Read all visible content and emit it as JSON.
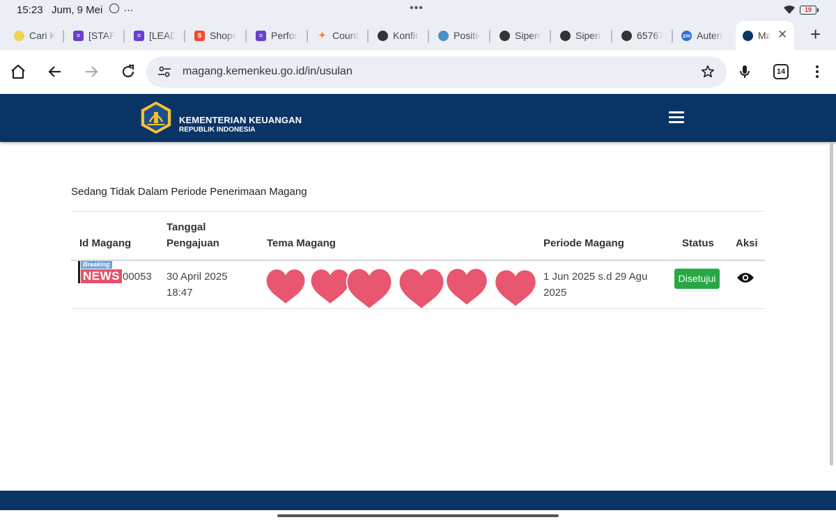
{
  "status_bar": {
    "time": "15:23",
    "date": "Jum, 9 Mei",
    "more": "…",
    "center_dots": "•••",
    "battery": "19"
  },
  "tabs": [
    {
      "title": "Cari K",
      "icon": "kakao-icon",
      "color": "#f3d24c"
    },
    {
      "title": "[STAF",
      "icon": "form-icon",
      "color": "#6a3fd1"
    },
    {
      "title": "[LEAD",
      "icon": "form-icon",
      "color": "#6a3fd1"
    },
    {
      "title": "Shope",
      "icon": "shopee-icon",
      "color": "#ee4d2d"
    },
    {
      "title": "Perfor",
      "icon": "form-icon",
      "color": "#6a3fd1"
    },
    {
      "title": "Count",
      "icon": "count-icon",
      "color": "#f08a24"
    },
    {
      "title": "Konfir",
      "icon": "globe-icon",
      "color": "#333333"
    },
    {
      "title": "Positic",
      "icon": "position-icon",
      "color": "#4a90c8"
    },
    {
      "title": "Siperr",
      "icon": "globe-icon",
      "color": "#333333"
    },
    {
      "title": "Siperr",
      "icon": "globe-icon",
      "color": "#333333"
    },
    {
      "title": "65767",
      "icon": "globe-icon",
      "color": "#333333"
    },
    {
      "title": "Auten",
      "icon": "zm-icon",
      "color": "#2a6bd8"
    },
    {
      "title": "Ma",
      "icon": "kemenkeu-icon",
      "color": "#0a3466",
      "active": true
    }
  ],
  "toolbar": {
    "url": "magang.kemenkeu.go.id/in/usulan",
    "tab_count": "14"
  },
  "site": {
    "brand_line1": "KEMENTERIAN KEUANGAN",
    "brand_line2": "REPUBLIK INDONESIA"
  },
  "main": {
    "notice": "Sedang Tidak Dalam Periode Penerimaan Magang",
    "columns": {
      "id": "Id Magang",
      "tanggal_1": "Tanggal",
      "tanggal_2": "Pengajuan",
      "tema": "Tema Magang",
      "periode": "Periode Magang",
      "status": "Status",
      "aksi": "Aksi"
    },
    "rows": [
      {
        "id_visible": "00053",
        "tanggal_1": "30 April 2025",
        "tanggal_2": "18:47",
        "periode_1": "1 Jun 2025 s.d 29 Agu",
        "periode_2": "2025",
        "status": "Disetujui"
      }
    ],
    "sticker": {
      "top": "Breaking",
      "bottom": "NEWS"
    }
  },
  "colors": {
    "header_bg": "#0a3466",
    "status_green": "#28a745",
    "heart": "#e8566f"
  }
}
